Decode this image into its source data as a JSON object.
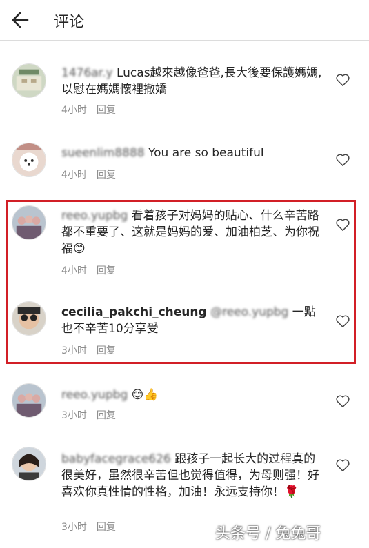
{
  "header": {
    "title": "评论"
  },
  "comments": [
    {
      "user": "1476ar.y",
      "text": "Lucas越來越像爸爸,長大後要保護媽媽, 以慰在媽媽懷裡撒嬌",
      "time": "4小时",
      "reply": "回复"
    },
    {
      "user": "sueenlim8888",
      "text": "You are so beautiful",
      "time": "4小时",
      "reply": "回复"
    },
    {
      "user": "reeo.yupbg",
      "text": "看着孩子对妈妈的贴心、什么辛苦路都不重要了、这就是妈妈的爱、加油柏芝、为你祝福😊",
      "time": "4小时",
      "reply": "回复"
    },
    {
      "user": "cecilia_pakchi_cheung",
      "mention": "@reeo.yupbg",
      "text": "一點也不辛苦10分享受",
      "time": "3小时",
      "reply": "回复"
    },
    {
      "user": "reeo.yupbg",
      "text": "😊👍",
      "time": "3小时",
      "reply": "回复"
    },
    {
      "user": "babyfacegrace626",
      "text": "跟孩子一起长大的过程真的很美好，虽然很辛苦但也觉得值得，为母则强！好喜欢你真性情的性格，加油！永远支持你！🌹",
      "time": "3小时",
      "reply": "回复"
    }
  ],
  "watermark": "头条号 / 兔兔哥",
  "colors": {
    "highlight_border": "#d21f26",
    "meta_text": "#8e8e8e"
  },
  "icons": {
    "back": "arrow-left-icon",
    "like": "heart-outline-icon"
  }
}
